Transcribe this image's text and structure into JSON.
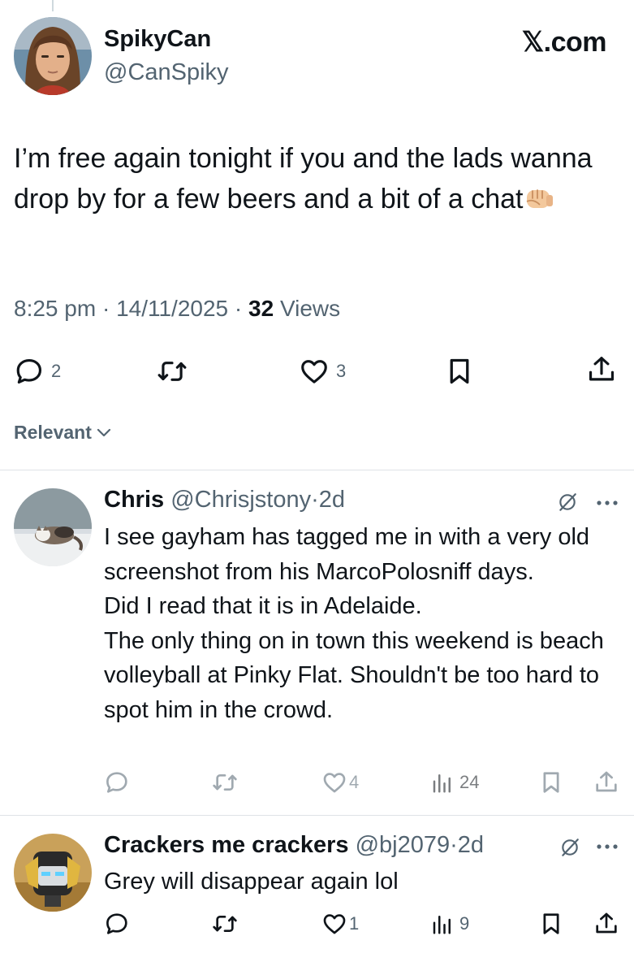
{
  "tweet": {
    "display_name": "SpikyCan",
    "handle": "@CanSpiky",
    "site_brand": "𝕏.com",
    "text": "I’m free again tonight if you and the lads wanna drop by for a few beers and a bit of a chat",
    "time": "8:25 pm",
    "date": "14/11/2025",
    "views_count": "32",
    "views_label": "Views",
    "reply_count": "2",
    "like_count": "3"
  },
  "sort": {
    "label": "Relevant"
  },
  "replies": [
    {
      "name": "Chris",
      "handle": "@Chrisjstony",
      "age": "2d",
      "lines": [
        "I see gayham has tagged me in with a very old screenshot from his MarcoPolosniff days.",
        "Did I read that it is in Adelaide.",
        "The only thing on in town this weekend is beach volleyball at Pinky Flat. Shouldn't be too hard to spot him in the crowd."
      ],
      "likes": "4",
      "views": "24"
    },
    {
      "name": "Crackers me crackers",
      "handle": "@bj2079",
      "age": "2d",
      "lines": [
        "Grey will disappear again lol"
      ],
      "likes": "1",
      "views": "9"
    }
  ],
  "icons": {
    "reply": "reply-icon",
    "retweet": "retweet-icon",
    "like": "heart-icon",
    "bookmark": "bookmark-icon",
    "share": "share-icon",
    "views": "views-chart-icon",
    "grok": "grok-icon",
    "more": "more-dots-icon",
    "emoji": "fist-emoji-icon"
  },
  "colors": {
    "text": "#0f1419",
    "secondary": "#536471",
    "divider": "#dfe3e6"
  }
}
